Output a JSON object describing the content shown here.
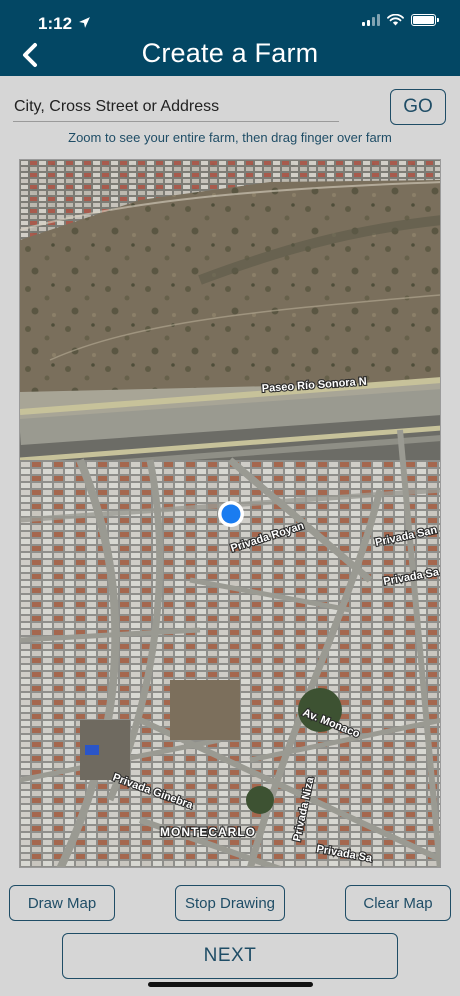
{
  "status": {
    "time": "1:12"
  },
  "header": {
    "title": "Create a Farm"
  },
  "search": {
    "placeholder": "City, Cross Street or Address",
    "go_label": "GO"
  },
  "hint": "Zoom to see your entire farm, then drag finger over farm",
  "map": {
    "labels": {
      "paseo": "Paseo Río Sonora N",
      "royan": "Privada Royan",
      "san1": "Privada San",
      "san2": "Privada Sa",
      "monaco": "Av. Monaco",
      "ginebra": "Privada Ginebra",
      "montecarlo": "MONTECARLO",
      "niza": "Privada Niza",
      "sa_bottom": "Privada Sa"
    }
  },
  "buttons": {
    "draw": "Draw Map",
    "stop": "Stop Drawing",
    "clear": "Clear Map",
    "next": "NEXT"
  },
  "colors": {
    "header": "#034764",
    "accent": "#1f4d66",
    "location_dot": "#1a7cf0"
  }
}
